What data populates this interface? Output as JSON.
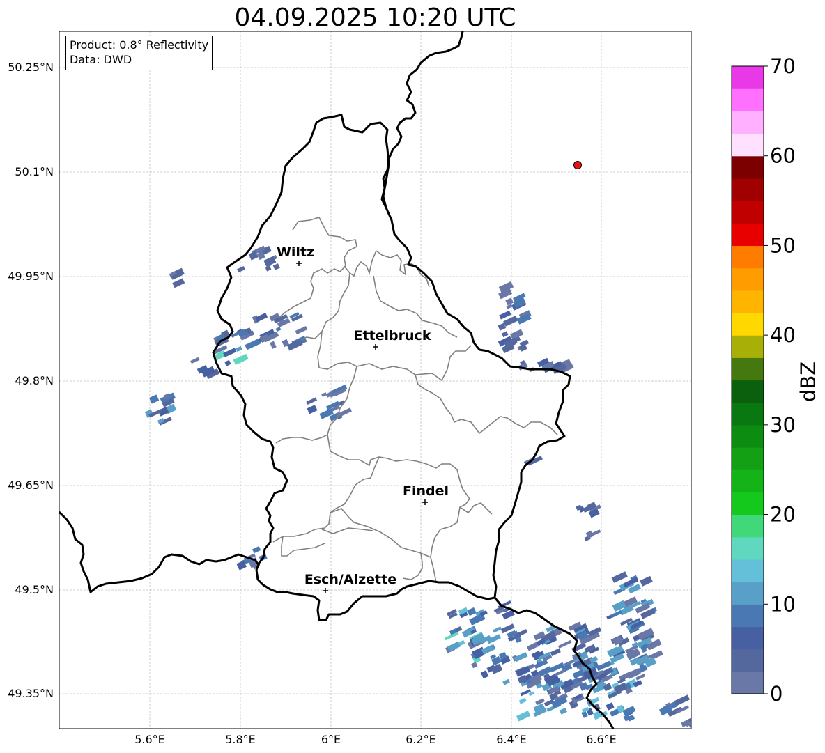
{
  "title": "04.09.2025 10:20 UTC",
  "info": {
    "product": "Product: 0.8° Reflectivity",
    "source": "Data: DWD"
  },
  "axes": {
    "lat_ticks": [
      "50.25°N",
      "50.1°N",
      "49.95°N",
      "49.8°N",
      "49.65°N",
      "49.5°N",
      "49.35°N"
    ],
    "lon_ticks": [
      "5.6°E",
      "5.8°E",
      "6°E",
      "6.2°E",
      "6.4°E",
      "6.6°E"
    ],
    "grid": true
  },
  "places": [
    {
      "name": "Wiltz"
    },
    {
      "name": "Ettelbruck"
    },
    {
      "name": "Findel"
    },
    {
      "name": "Esch/Alzette"
    }
  ],
  "marker": {
    "type": "radar-site",
    "color": "#ee1111"
  },
  "colorbar": {
    "label": "dBZ",
    "min": 0,
    "max": 70,
    "tick_labels": [
      "0",
      "10",
      "20",
      "30",
      "40",
      "50",
      "60",
      "70"
    ],
    "colors": [
      "#6a78a8",
      "#54689e",
      "#4660a2",
      "#4a78b2",
      "#58a0c8",
      "#64c0d8",
      "#60d8c0",
      "#40d878",
      "#14c81c",
      "#14b418",
      "#14a014",
      "#0c8c10",
      "#0a7810",
      "#0a600c",
      "#467810",
      "#a8b008",
      "#ffd800",
      "#ffb400",
      "#ff9c00",
      "#ff7c00",
      "#e80000",
      "#c00000",
      "#a00000",
      "#7c0000",
      "#ffe0ff",
      "#ffb0ff",
      "#ff70ff",
      "#e838e8"
    ]
  },
  "colors": {
    "country_border": "#000000",
    "canton_border": "#808080",
    "grid": "#c0c0c0"
  }
}
